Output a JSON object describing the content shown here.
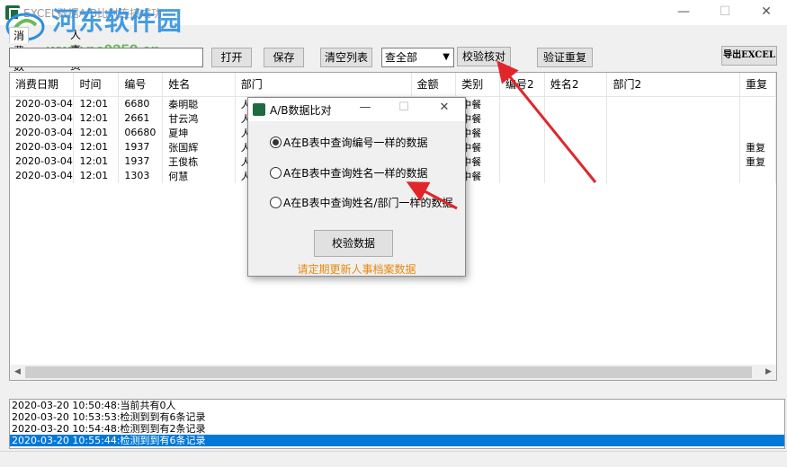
{
  "window": {
    "title": "EXCEL数据A/B比对连接成功",
    "controls": [
      "—",
      "☐",
      "✕"
    ]
  },
  "watermark": {
    "text": "河东软件园",
    "url": "www.pc0359.cn"
  },
  "tabs": [
    "消费数据",
    "人事资料"
  ],
  "toolbar": {
    "search_value": "",
    "open_label": "打开",
    "save_label": "保存",
    "clear_label": "清空列表",
    "filter_selected": "查全部",
    "verify_label": "校验核对",
    "check_dup_label": "验证重复",
    "export_label": "导出EXCEL"
  },
  "grid": {
    "columns": [
      "消费日期",
      "时间",
      "编号",
      "姓名",
      "部门",
      "金额",
      "类别",
      "编号2",
      "姓名2",
      "部门2",
      "重复"
    ],
    "rows": [
      [
        "2020-03-04",
        "12:01",
        "6680",
        "秦明聪",
        "人",
        "",
        "中餐",
        "",
        "",
        "",
        ""
      ],
      [
        "2020-03-04",
        "12:01",
        "2661",
        "甘云鸿",
        "人",
        "",
        "中餐",
        "",
        "",
        "",
        ""
      ],
      [
        "2020-03-04",
        "12:01",
        "06680",
        "夏坤",
        "人",
        "",
        "中餐",
        "",
        "",
        "",
        ""
      ],
      [
        "2020-03-04",
        "12:01",
        "1937",
        "张国辉",
        "人",
        "",
        "中餐",
        "",
        "",
        "",
        "重复"
      ],
      [
        "2020-03-04",
        "12:01",
        "1937",
        "王俊栋",
        "人",
        "",
        "中餐",
        "",
        "",
        "",
        "重复"
      ],
      [
        "2020-03-04",
        "12:01",
        "1303",
        "何慧",
        "人",
        "",
        "中餐",
        "",
        "",
        "",
        ""
      ]
    ]
  },
  "log": [
    "2020-03-20 10:50:48:当前共有0人",
    "2020-03-20 10:53:53:检测到到有6条记录",
    "2020-03-20 10:54:48:检测到到有2条记录",
    "2020-03-20 10:55:44:检测到到有6条记录"
  ],
  "dialog": {
    "title": "A/B数据比对",
    "options": [
      "A在B表中查询编号一样的数据",
      "A在B表中查询姓名一样的数据",
      "A在B表中查询姓名/部门一样的数据"
    ],
    "selected_index": 0,
    "button_label": "校验数据",
    "note": "请定期更新人事档案数据"
  },
  "colors": {
    "accent": "#0078d7",
    "annotation_arrow": "#e0262b",
    "note": "#e8890c"
  }
}
